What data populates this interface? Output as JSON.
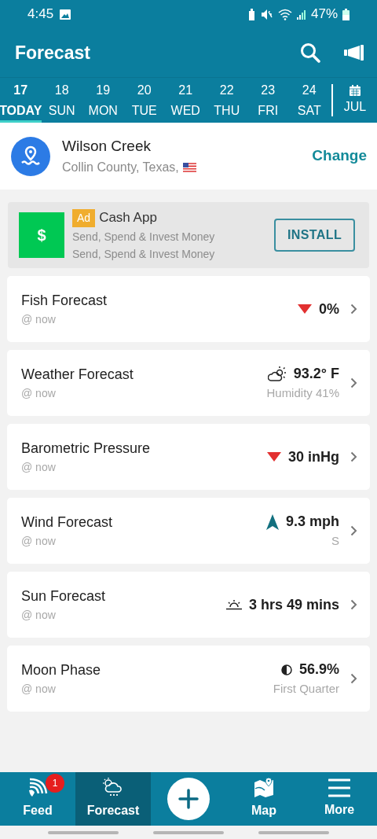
{
  "status_bar": {
    "time": "4:45",
    "battery": "47%"
  },
  "app_bar": {
    "title": "Forecast"
  },
  "days": [
    {
      "number": "17",
      "label": "TODAY",
      "selected": true
    },
    {
      "number": "18",
      "label": "SUN",
      "selected": false
    },
    {
      "number": "19",
      "label": "MON",
      "selected": false
    },
    {
      "number": "20",
      "label": "TUE",
      "selected": false
    },
    {
      "number": "21",
      "label": "WED",
      "selected": false
    },
    {
      "number": "22",
      "label": "THU",
      "selected": false
    },
    {
      "number": "23",
      "label": "FRI",
      "selected": false
    },
    {
      "number": "24",
      "label": "SAT",
      "selected": false
    }
  ],
  "month": "JUL",
  "location": {
    "name": "Wilson Creek",
    "region": "Collin County, Texas,",
    "action": "Change"
  },
  "ad": {
    "logo": "$",
    "badge": "Ad",
    "title": "Cash App",
    "lines": [
      "Send, Spend & Invest Money",
      "Send, Spend & Invest Money"
    ],
    "button": "INSTALL"
  },
  "cards": [
    {
      "kind": "fish",
      "title": "Fish Forecast",
      "subtitle": "@ now",
      "value": "0%"
    },
    {
      "kind": "weather",
      "title": "Weather Forecast",
      "subtitle": "@ now",
      "value": "93.2° F",
      "detail": "Humidity 41%"
    },
    {
      "kind": "pressure",
      "title": "Barometric Pressure",
      "subtitle": "@ now",
      "value": "30 inHg"
    },
    {
      "kind": "wind",
      "title": "Wind Forecast",
      "subtitle": "@ now",
      "value": "9.3 mph",
      "detail": "S"
    },
    {
      "kind": "sun",
      "title": "Sun Forecast",
      "subtitle": "@ now",
      "value": "3 hrs 49 mins"
    },
    {
      "kind": "moon",
      "title": "Moon Phase",
      "subtitle": "@ now",
      "value": "56.9%",
      "detail": "First Quarter"
    }
  ],
  "bottom_nav": [
    {
      "kind": "feed",
      "label": "Feed",
      "badge": "1",
      "selected": false
    },
    {
      "kind": "forecast",
      "label": "Forecast",
      "selected": true
    },
    {
      "kind": "add"
    },
    {
      "kind": "map",
      "label": "Map",
      "selected": false
    },
    {
      "kind": "more",
      "label": "More",
      "selected": false
    }
  ]
}
